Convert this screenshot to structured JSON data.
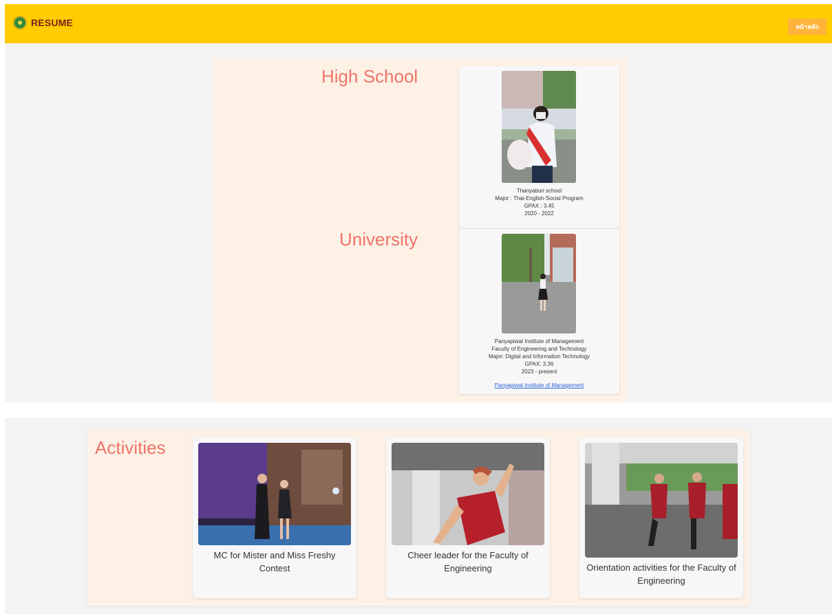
{
  "header": {
    "brand": "RESUME",
    "home_button": "หน้าหลัก",
    "colors": {
      "bar": "#ffcc00",
      "button": "#ffb33b",
      "brand_text": "#7a1f1f"
    }
  },
  "education": {
    "high_school": {
      "heading": "High School",
      "school": "Thanyaburi school",
      "major": "Major : Thai-English-Social Program",
      "gpax": "GPAX : 3.45",
      "years": "2020 - 2022"
    },
    "university": {
      "heading": "University",
      "school": "Panyapiwat Institute of Management",
      "faculty": "Faculty of Engineering and Technology",
      "major": "Major: Digital and Information Technology",
      "gpax": "GPAX: 3.36",
      "years": "2023 - present",
      "link": "Panyapiwat Institute of Management"
    }
  },
  "activities": {
    "heading": "Activities",
    "items": [
      {
        "caption": "MC for Mister and Miss Freshy Contest"
      },
      {
        "caption": "Cheer leader for the Faculty of Engineering"
      },
      {
        "caption": "Orientation activities for the Faculty of Engineering"
      }
    ]
  },
  "colors": {
    "heading": "#ee7468",
    "panel": "#fdf1e6",
    "background": "#f3f3f3",
    "link": "#2a60d6"
  }
}
